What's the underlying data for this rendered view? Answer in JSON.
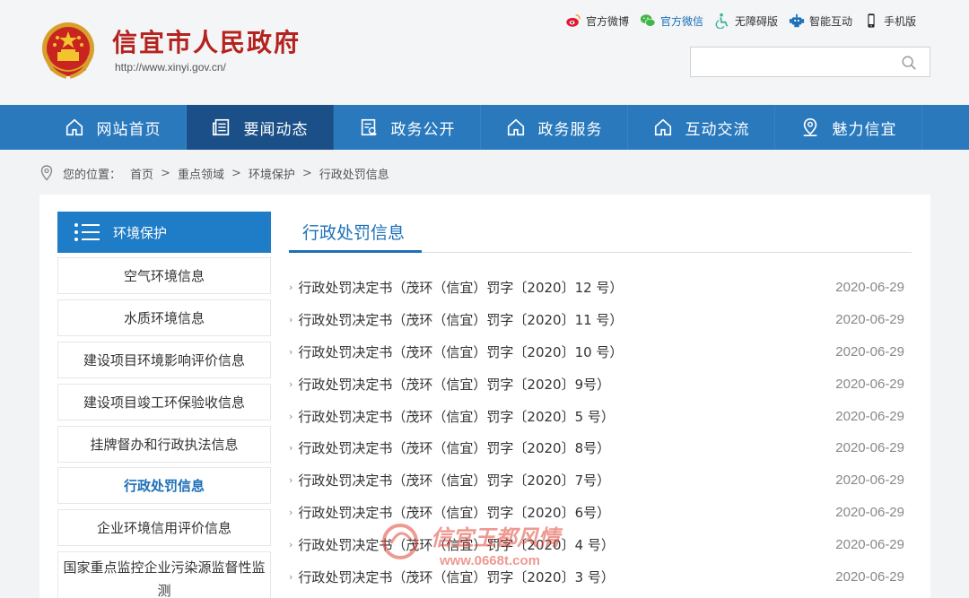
{
  "header": {
    "site_title": "信宜市人民政府",
    "site_url": "http://www.xinyi.gov.cn/",
    "top_links": [
      {
        "label": "官方微博",
        "icon": "weibo-icon"
      },
      {
        "label": "官方微信",
        "icon": "wechat-icon"
      },
      {
        "label": "无障碍版",
        "icon": "accessibility-icon"
      },
      {
        "label": "智能互动",
        "icon": "robot-icon"
      },
      {
        "label": "手机版",
        "icon": "mobile-icon"
      }
    ],
    "search": {
      "placeholder": "",
      "value": ""
    }
  },
  "nav": {
    "items": [
      {
        "label": "网站首页",
        "icon": "home-icon"
      },
      {
        "label": "要闻动态",
        "icon": "news-icon"
      },
      {
        "label": "政务公开",
        "icon": "document-icon"
      },
      {
        "label": "政务服务",
        "icon": "home-icon"
      },
      {
        "label": "互动交流",
        "icon": "home-icon"
      },
      {
        "label": "魅力信宜",
        "icon": "user-pin-icon"
      }
    ],
    "active_index": 1
  },
  "breadcrumb": {
    "prefix": "您的位置：",
    "items": [
      "首页",
      "重点领域",
      "环境保护",
      "行政处罚信息"
    ],
    "separator": ">"
  },
  "sidebar": {
    "heading": "环境保护",
    "items": [
      {
        "label": "空气环境信息"
      },
      {
        "label": "水质环境信息"
      },
      {
        "label": "建设项目环境影响评价信息"
      },
      {
        "label": "建设项目竣工环保验收信息"
      },
      {
        "label": "挂牌督办和行政执法信息"
      },
      {
        "label": "行政处罚信息"
      },
      {
        "label": "企业环境信用评价信息"
      },
      {
        "label": "国家重点监控企业污染源监督性监测"
      }
    ],
    "active_index": 5
  },
  "content": {
    "title": "行政处罚信息",
    "rows": [
      {
        "title": "行政处罚决定书（茂环（信宜）罚字〔2020〕12 号）",
        "date": "2020-06-29"
      },
      {
        "title": "行政处罚决定书（茂环（信宜）罚字〔2020〕11 号）",
        "date": "2020-06-29"
      },
      {
        "title": "行政处罚决定书（茂环（信宜）罚字〔2020〕10 号）",
        "date": "2020-06-29"
      },
      {
        "title": "行政处罚决定书（茂环（信宜）罚字〔2020〕9号）",
        "date": "2020-06-29"
      },
      {
        "title": "行政处罚决定书（茂环（信宜）罚字〔2020〕5 号）",
        "date": "2020-06-29"
      },
      {
        "title": "行政处罚决定书（茂环（信宜）罚字〔2020〕8号）",
        "date": "2020-06-29"
      },
      {
        "title": "行政处罚决定书（茂环（信宜）罚字〔2020〕7号）",
        "date": "2020-06-29"
      },
      {
        "title": "行政处罚决定书（茂环（信宜）罚字〔2020〕6号）",
        "date": "2020-06-29"
      },
      {
        "title": "行政处罚决定书（茂环（信宜）罚字〔2020〕4 号）",
        "date": "2020-06-29"
      },
      {
        "title": "行政处罚决定书（茂环（信宜）罚字〔2020〕3 号）",
        "date": "2020-06-29"
      }
    ]
  },
  "watermark": {
    "text": "信宜玉都风情",
    "url": "www.0668t.com"
  },
  "colors": {
    "nav_bg": "#2a79bd",
    "nav_active": "#1a4f87",
    "accent": "#1d70b8",
    "title_red": "#b5231f"
  }
}
